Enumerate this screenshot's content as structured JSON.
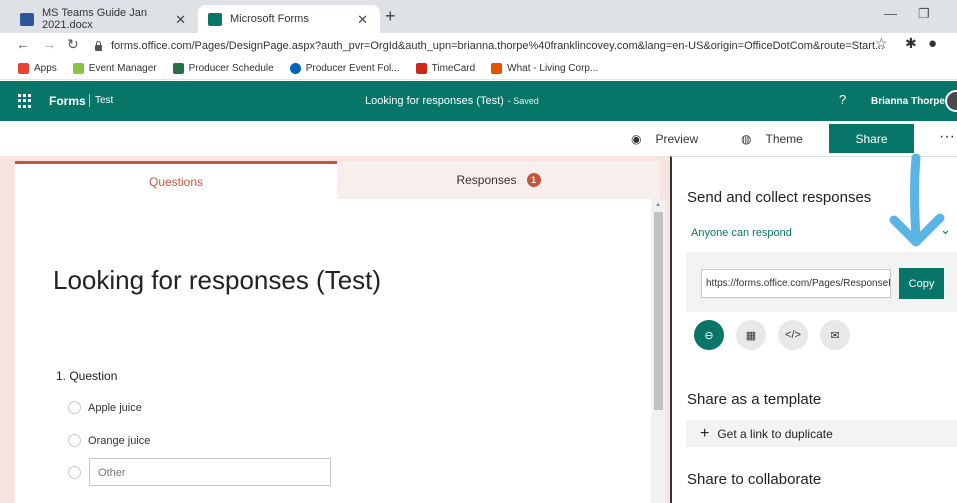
{
  "browser": {
    "tabs": [
      {
        "title": "MS Teams Guide Jan 2021.docx",
        "icon": "word-icon",
        "color": "#2b579a"
      },
      {
        "title": "Microsoft Forms",
        "icon": "forms-icon",
        "color": "#077568"
      }
    ],
    "new_tab": "+",
    "url": "forms.office.com/Pages/DesignPage.aspx?auth_pvr=OrgId&auth_upn=brianna.thorpe%40franklincovey.com&lang=en-US&origin=OfficeDotCom&route=Start...",
    "bookmarks": [
      {
        "label": "Apps",
        "icon": "apps-grid-icon",
        "color": "#ea4335"
      },
      {
        "label": "Event Manager",
        "icon": "leaf-icon",
        "color": "#8bc34a"
      },
      {
        "label": "Producer Schedule",
        "icon": "excel-icon",
        "color": "#217346"
      },
      {
        "label": "Producer Event Fol...",
        "icon": "onedrive-icon",
        "color": "#0364b8"
      },
      {
        "label": "TimeCard",
        "icon": "adp-icon",
        "color": "#d0271d"
      },
      {
        "label": "What - Living Corp...",
        "icon": "flag-icon",
        "color": "#e65100"
      }
    ]
  },
  "forms_header": {
    "brand": "Forms",
    "sub": "Test",
    "title": "Looking for responses (Test)",
    "saved": "- Saved",
    "help": "?",
    "user": "Brianna Thorpe"
  },
  "commands": {
    "preview": "Preview",
    "theme": "Theme",
    "share": "Share",
    "more": "···"
  },
  "form": {
    "tabs": {
      "questions": "Questions",
      "responses": "Responses",
      "responses_count": "1"
    },
    "title": "Looking for responses (Test)",
    "question": "1. Question",
    "options": [
      "Apple juice",
      "Orange juice"
    ],
    "other_placeholder": "Other"
  },
  "share_panel": {
    "title": "Send and collect responses",
    "audience": "Anyone can respond",
    "link": "https://forms.office.com/Pages/ResponsePage.aspx",
    "copy": "Copy",
    "template_title": "Share as a template",
    "duplicate": "Get a link to duplicate",
    "collaborate_title": "Share to collaborate"
  },
  "colors": {
    "accent": "#077568",
    "questions_tab": "#c4543c",
    "annotation_arrow": "#5ab4e6"
  }
}
